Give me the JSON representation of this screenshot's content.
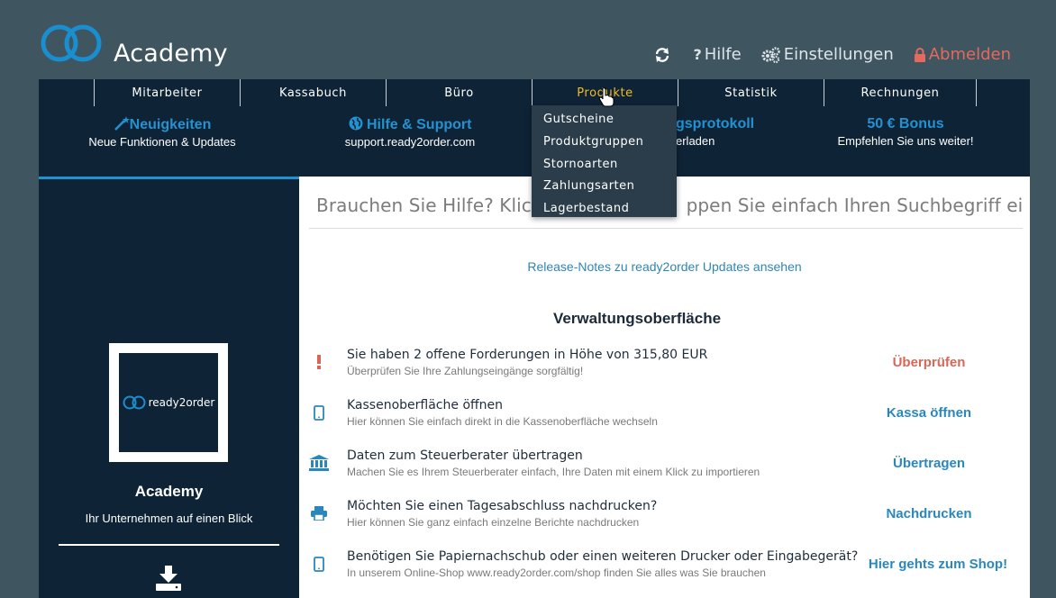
{
  "header": {
    "brand": "Academy",
    "actions": {
      "refresh_label": "",
      "help_label": "Hilfe",
      "settings_label": "Einstellungen",
      "logout_label": "Abmelden"
    }
  },
  "nav": {
    "items": [
      {
        "label": "Mitarbeiter"
      },
      {
        "label": "Kassabuch"
      },
      {
        "label": "Büro"
      },
      {
        "label": "Produkte"
      },
      {
        "label": "Statistik"
      },
      {
        "label": "Rechnungen"
      }
    ],
    "active": "Produkte"
  },
  "features": [
    {
      "title": "Neuigkeiten",
      "subtitle": "Neue Funktionen & Updates"
    },
    {
      "title": "Hilfe & Support",
      "subtitle": "support.ready2order.com"
    },
    {
      "title": "gsprotokoll",
      "subtitle": "erladen"
    },
    {
      "title": "50 € Bonus",
      "subtitle": "Empfehlen Sie uns weiter!"
    }
  ],
  "dropdown": {
    "items": [
      "Gutscheine",
      "Produktgruppen",
      "Stornoarten",
      "Zahlungsarten",
      "Lagerbestand"
    ]
  },
  "sidebar": {
    "logo_text": "ready2order",
    "title": "Academy",
    "subtitle": "Ihr Unternehmen auf einen Blick"
  },
  "content": {
    "search_placeholder": "Brauchen Sie Hilfe? Klick",
    "search_placeholder_tail": "ppen Sie einfach Ihren Suchbegriff ein...",
    "release_link": "Release-Notes zu ready2order Updates ansehen",
    "section_title": "Verwaltungsoberfläche",
    "rows": [
      {
        "icon": "exclamation-icon",
        "title": "Sie haben 2 offene Forderungen in Höhe von 315,80 EUR",
        "desc": "Überprüfen Sie Ihre Zahlungseingänge sorgfältig!",
        "action": "Überprüfen"
      },
      {
        "icon": "tablet-icon",
        "title": "Kassenoberfläche öffnen",
        "desc": "Hier können Sie einfach direkt in die Kassenoberfläche wechseln",
        "action": "Kassa öffnen"
      },
      {
        "icon": "bank-icon",
        "title": "Daten zum Steuerberater übertragen",
        "desc": "Machen Sie es Ihrem Steuerberater einfach, Ihre Daten mit einem Klick zu importieren",
        "action": "Übertragen"
      },
      {
        "icon": "printer-icon",
        "title": "Möchten Sie einen Tagesabschluss nachdrucken?",
        "desc": "Hier können Sie ganz einfach einzelne Berichte nachdrucken",
        "action": "Nachdrucken"
      },
      {
        "icon": "tablet-icon",
        "title": "Benötigen Sie Papiernachschub oder einen weiteren Drucker oder Eingabegerät?",
        "desc": "In unserem Online-Shop www.ready2order.com/shop finden Sie alles was Sie brauchen",
        "action": "Hier gehts zum Shop!"
      }
    ]
  },
  "colors": {
    "accent": "#2392d1",
    "active_nav": "#f0bc24",
    "warn": "#d96656",
    "panel": "#0e2336"
  }
}
